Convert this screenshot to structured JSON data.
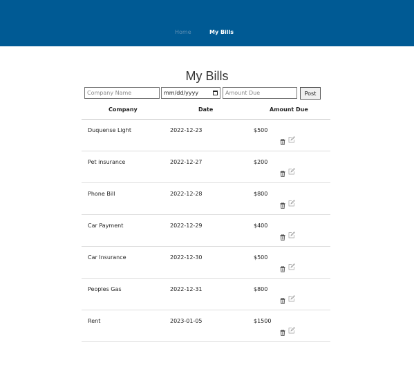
{
  "nav": {
    "home_label": "Home",
    "bills_label": "My Bills"
  },
  "page": {
    "title": "My Bills"
  },
  "form": {
    "company_placeholder": "Company Name",
    "date_placeholder": "mm/dd/yyyy",
    "amount_placeholder": "Amount Due",
    "post_label": "Post",
    "calendar_icon": "calendar-icon"
  },
  "table": {
    "headers": {
      "company": "Company",
      "date": "Date",
      "amount": "Amount Due"
    },
    "rows": [
      {
        "company": "Duquense Light",
        "date": "2022-12-23",
        "amount": "$500"
      },
      {
        "company": "Pet insurance",
        "date": "2022-12-27",
        "amount": "$200"
      },
      {
        "company": "Phone Bill",
        "date": "2022-12-28",
        "amount": "$800"
      },
      {
        "company": "Car Payment",
        "date": "2022-12-29",
        "amount": "$400"
      },
      {
        "company": "Car Insurance",
        "date": "2022-12-30",
        "amount": "$500"
      },
      {
        "company": "Peoples Gas",
        "date": "2022-12-31",
        "amount": "$800"
      },
      {
        "company": "Rent",
        "date": "2023-01-05",
        "amount": "$1500"
      }
    ],
    "row_actions": {
      "delete_icon": "trash-icon",
      "edit_icon": "edit-icon"
    }
  },
  "colors": {
    "navbar": "#005a94",
    "nav_active": "#ffffff",
    "nav_inactive": "#5d8fb4"
  }
}
